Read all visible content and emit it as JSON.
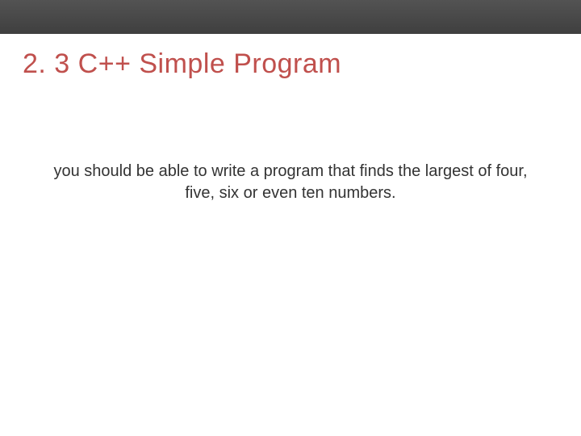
{
  "slide": {
    "title": "2. 3 C++ Simple Program",
    "body": "you should be able to write a program that finds the largest of four, five, six or even ten numbers."
  },
  "colors": {
    "accent": "#c0504d",
    "top_band": "#4a4a4a"
  }
}
